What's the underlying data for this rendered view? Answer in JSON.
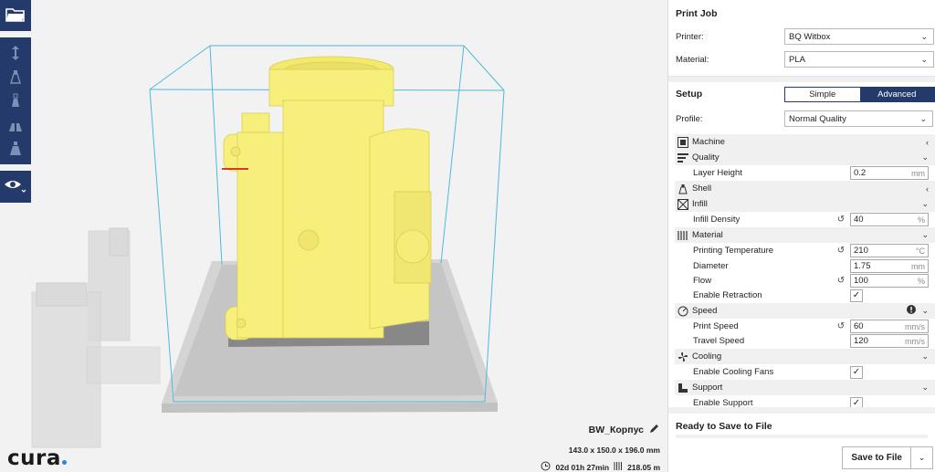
{
  "viewport": {
    "model_name": "BW_Корпус",
    "model_dims": "143.0 x 150.0 x 196.0 mm",
    "print_time": "02d 01h 27min",
    "filament_length": "218.05 m",
    "logo_text": "cura"
  },
  "toolbar": {
    "open_icon": "folder-open-icon",
    "tools": [
      "translate-icon",
      "scale-icon",
      "rotate-icon",
      "mirror-icon",
      "per-model-settings-icon"
    ],
    "view_icon": "eye-icon"
  },
  "print_job": {
    "title": "Print Job",
    "printer_label": "Printer:",
    "printer_value": "BQ Witbox",
    "material_label": "Material:",
    "material_value": "PLA"
  },
  "setup": {
    "title": "Setup",
    "mode_simple": "Simple",
    "mode_advanced": "Advanced",
    "profile_label": "Profile:",
    "profile_value": "Normal Quality"
  },
  "settings": {
    "machine": "Machine",
    "quality": "Quality",
    "layer_height": {
      "label": "Layer Height",
      "value": "0.2",
      "unit": "mm"
    },
    "shell": "Shell",
    "infill": "Infill",
    "infill_density": {
      "label": "Infill Density",
      "value": "40",
      "unit": "%"
    },
    "material": "Material",
    "printing_temperature": {
      "label": "Printing Temperature",
      "value": "210",
      "unit": "°C"
    },
    "diameter": {
      "label": "Diameter",
      "value": "1.75",
      "unit": "mm"
    },
    "flow": {
      "label": "Flow",
      "value": "100",
      "unit": "%"
    },
    "enable_retraction": {
      "label": "Enable Retraction",
      "checked": true
    },
    "speed": "Speed",
    "print_speed": {
      "label": "Print Speed",
      "value": "60",
      "unit": "mm/s"
    },
    "travel_speed": {
      "label": "Travel Speed",
      "value": "120",
      "unit": "mm/s"
    },
    "cooling": "Cooling",
    "enable_cooling_fans": {
      "label": "Enable Cooling Fans",
      "checked": true
    },
    "support": "Support",
    "enable_support": {
      "label": "Enable Support",
      "checked": true
    }
  },
  "ready": {
    "title": "Ready to Save to File",
    "save_label": "Save to File"
  },
  "colors": {
    "accent": "#243a6b",
    "model": "#f7ef7c",
    "box": "#4fb8e0"
  }
}
